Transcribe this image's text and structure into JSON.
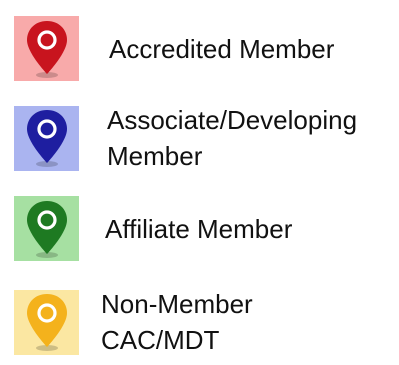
{
  "legend": {
    "items": [
      {
        "icon": "red-map-pin-icon",
        "swatch_color": "#f8aaaa",
        "pin_color": "#c8141e",
        "lines": [
          "Accredited Member"
        ]
      },
      {
        "icon": "blue-map-pin-icon",
        "swatch_color": "#aab4f0",
        "pin_color": "#1e1ea0",
        "lines": [
          "Associate/Developing",
          "Member"
        ]
      },
      {
        "icon": "green-map-pin-icon",
        "swatch_color": "#a6e0a2",
        "pin_color": "#1e7a22",
        "lines": [
          "Affiliate Member"
        ]
      },
      {
        "icon": "yellow-map-pin-icon",
        "swatch_color": "#fbe7a2",
        "pin_color": "#f4b21c",
        "lines": [
          "Non-Member",
          "CAC/MDT"
        ]
      }
    ]
  }
}
